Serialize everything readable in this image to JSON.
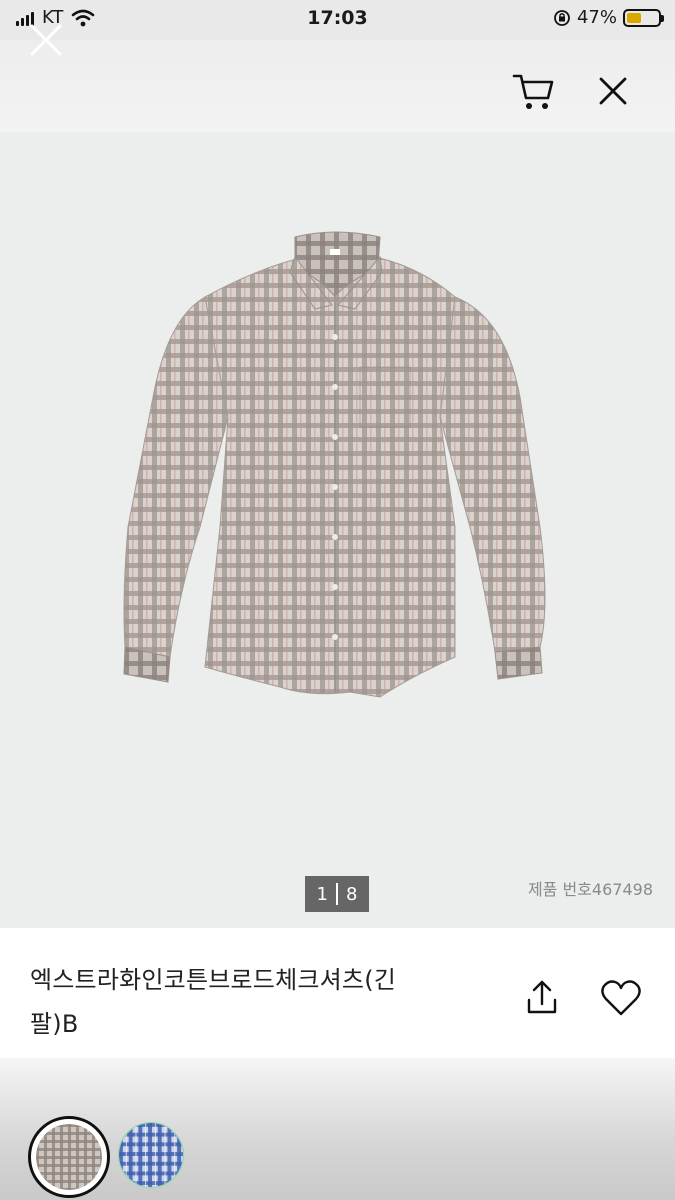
{
  "status_bar": {
    "carrier": "KT",
    "time": "17:03",
    "battery_percent": "47%",
    "battery_level": 0.47,
    "battery_color": "#d9a800"
  },
  "header": {
    "icons": [
      "close-icon",
      "cart-icon",
      "close-icon"
    ]
  },
  "gallery": {
    "current": "1",
    "total": "8",
    "product_number": "제품 번호467498"
  },
  "product": {
    "title_line1": "엑스트라화인코튼브로드체크셔츠(긴",
    "title_line2": "팔)B"
  },
  "actions": {
    "icons": [
      "share-icon",
      "heart-icon"
    ]
  },
  "swatches": [
    {
      "name": "beige-check",
      "selected": true,
      "color": "#b8aca4"
    },
    {
      "name": "blue-check",
      "selected": false,
      "color": "#4f6fb8"
    }
  ]
}
